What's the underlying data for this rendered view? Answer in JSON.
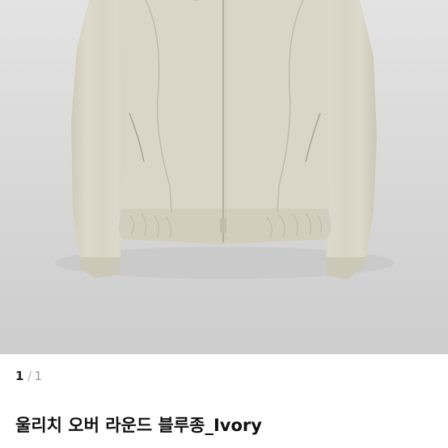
{
  "product": {
    "image_alt_icon": "jacket-photo",
    "colors": {
      "background": "#d9d9d9",
      "jacket": "#d9d6c8",
      "jacket_shadow": "#c6c2b2",
      "seam": "#bdb8a6"
    }
  },
  "pager": {
    "current": "1",
    "separator": "/",
    "total": "1"
  },
  "title": "울리치 오버 라운드 블루종_Ivory"
}
